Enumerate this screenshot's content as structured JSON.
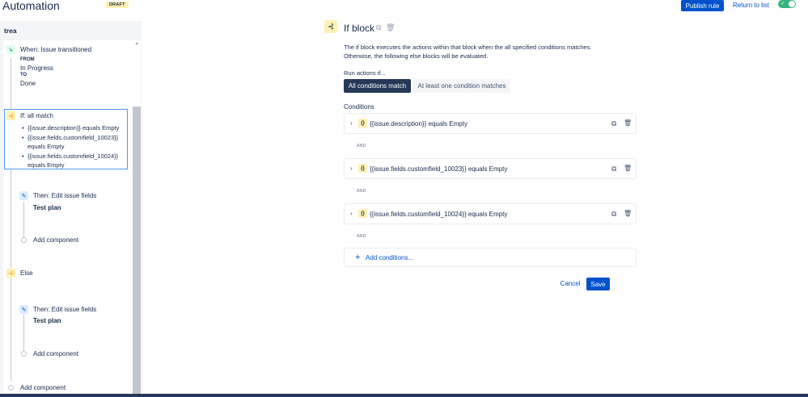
{
  "header": {
    "title": "Automation",
    "draft_badge": "DRAFT",
    "publish_label": "Publish rule",
    "return_label": "Return to list",
    "toggle_on": true
  },
  "sidebar": {
    "rule_name": "trea",
    "trigger": {
      "title": "When: Issue transitioned",
      "from_label": "FROM",
      "from_value": "In Progress",
      "to_label": "TO",
      "to_value": "Done"
    },
    "if_block": {
      "title": "If: all match",
      "conditions": [
        "{{issue.description}} equals Empty",
        "{{issue.fields.customfield_10023}} equals Empty",
        "{{issue.fields.customfield_10024}} equals Empty"
      ]
    },
    "then_action_1": {
      "title": "Then: Edit issue fields",
      "detail": "Test plan"
    },
    "add_component_1": "Add component",
    "else_title": "Else",
    "then_action_2": {
      "title": "Then: Edit issue fields",
      "detail": "Test plan"
    },
    "add_component_2": "Add component",
    "add_component_root": "Add component"
  },
  "main": {
    "title": "If block",
    "description": "The if block executes the actions within that block when the all specified conditions matches. Otherwise, the following else blocks will be evaluated.",
    "run_actions_label": "Run actions if...",
    "match_options": [
      "All conditions match",
      "At least one condition matches"
    ],
    "selected_match": "All conditions match",
    "conditions_label": "Conditions",
    "conditions": [
      "{{issue.description}} equals Empty",
      "{{issue.fields.customfield_10023}} equals Empty",
      "{{issue.fields.customfield_10024}} equals Empty"
    ],
    "and_label": "AND",
    "add_conditions_label": "Add conditions...",
    "cancel_label": "Cancel",
    "save_label": "Save"
  },
  "colors": {
    "primary": "#0052cc",
    "selected_tab": "#253858",
    "condition_icon_bg": "#fff0b3",
    "toggle_on": "#36b37e"
  },
  "icons": {
    "trigger": "trigger-icon",
    "condition": "branch-icon",
    "action": "pencil-icon",
    "copy": "copy-icon",
    "delete": "trash-icon",
    "expand": "chevron-right-icon",
    "smart_value": "braces-icon"
  }
}
